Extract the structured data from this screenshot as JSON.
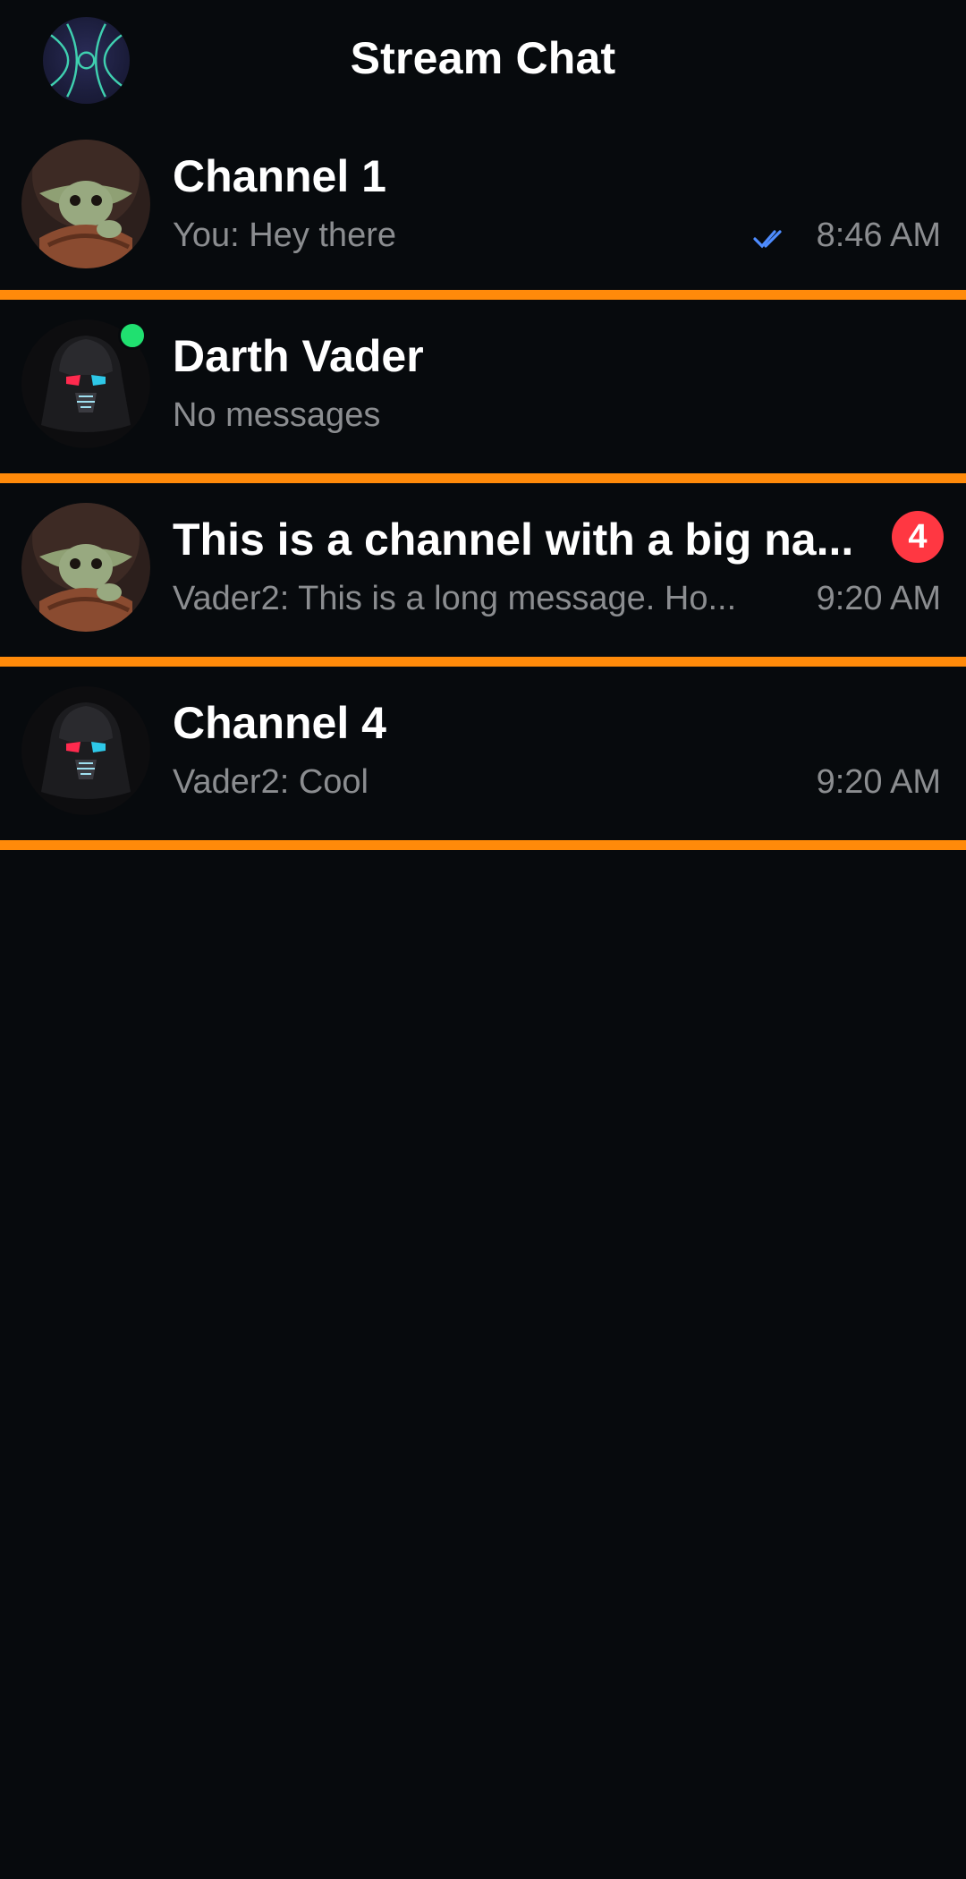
{
  "header": {
    "title": "Stream Chat",
    "logo_icon": "stream-logo-icon"
  },
  "colors": {
    "background": "#070a0d",
    "divider": "#ff8a0a",
    "online": "#20e070",
    "badge": "#ff3742",
    "read_check": "#4e8cff",
    "subtext": "#8b8d90"
  },
  "channels": [
    {
      "title": "Channel 1",
      "preview": "You: Hey there",
      "time": "8:46 AM",
      "avatar": "yoda-avatar",
      "read": true
    },
    {
      "title": "Darth Vader",
      "preview": "No messages",
      "time": "",
      "avatar": "vader-avatar",
      "online": true
    },
    {
      "title": "This is a channel with a big na...",
      "preview": "Vader2: This is a long message. Ho...",
      "time": "9:20 AM",
      "avatar": "yoda-avatar",
      "unread": "4"
    },
    {
      "title": "Channel 4",
      "preview": "Vader2: Cool",
      "time": "9:20 AM",
      "avatar": "vader-avatar"
    }
  ]
}
